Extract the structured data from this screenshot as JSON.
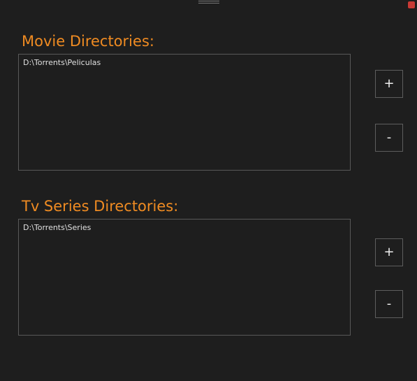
{
  "movies": {
    "title": "Movie Directories:",
    "items": [
      "D:\\Torrents\\Peliculas"
    ],
    "add_label": "+",
    "remove_label": "-"
  },
  "series": {
    "title": "Tv Series Directories:",
    "items": [
      "D:\\Torrents\\Series"
    ],
    "add_label": "+",
    "remove_label": "-"
  },
  "colors": {
    "accent": "#ef8b22",
    "background": "#1e1e1e",
    "border": "#595959",
    "close": "#c83a35"
  },
  "icons": {
    "drag": "drag-handle-icon",
    "close": "close-icon"
  }
}
